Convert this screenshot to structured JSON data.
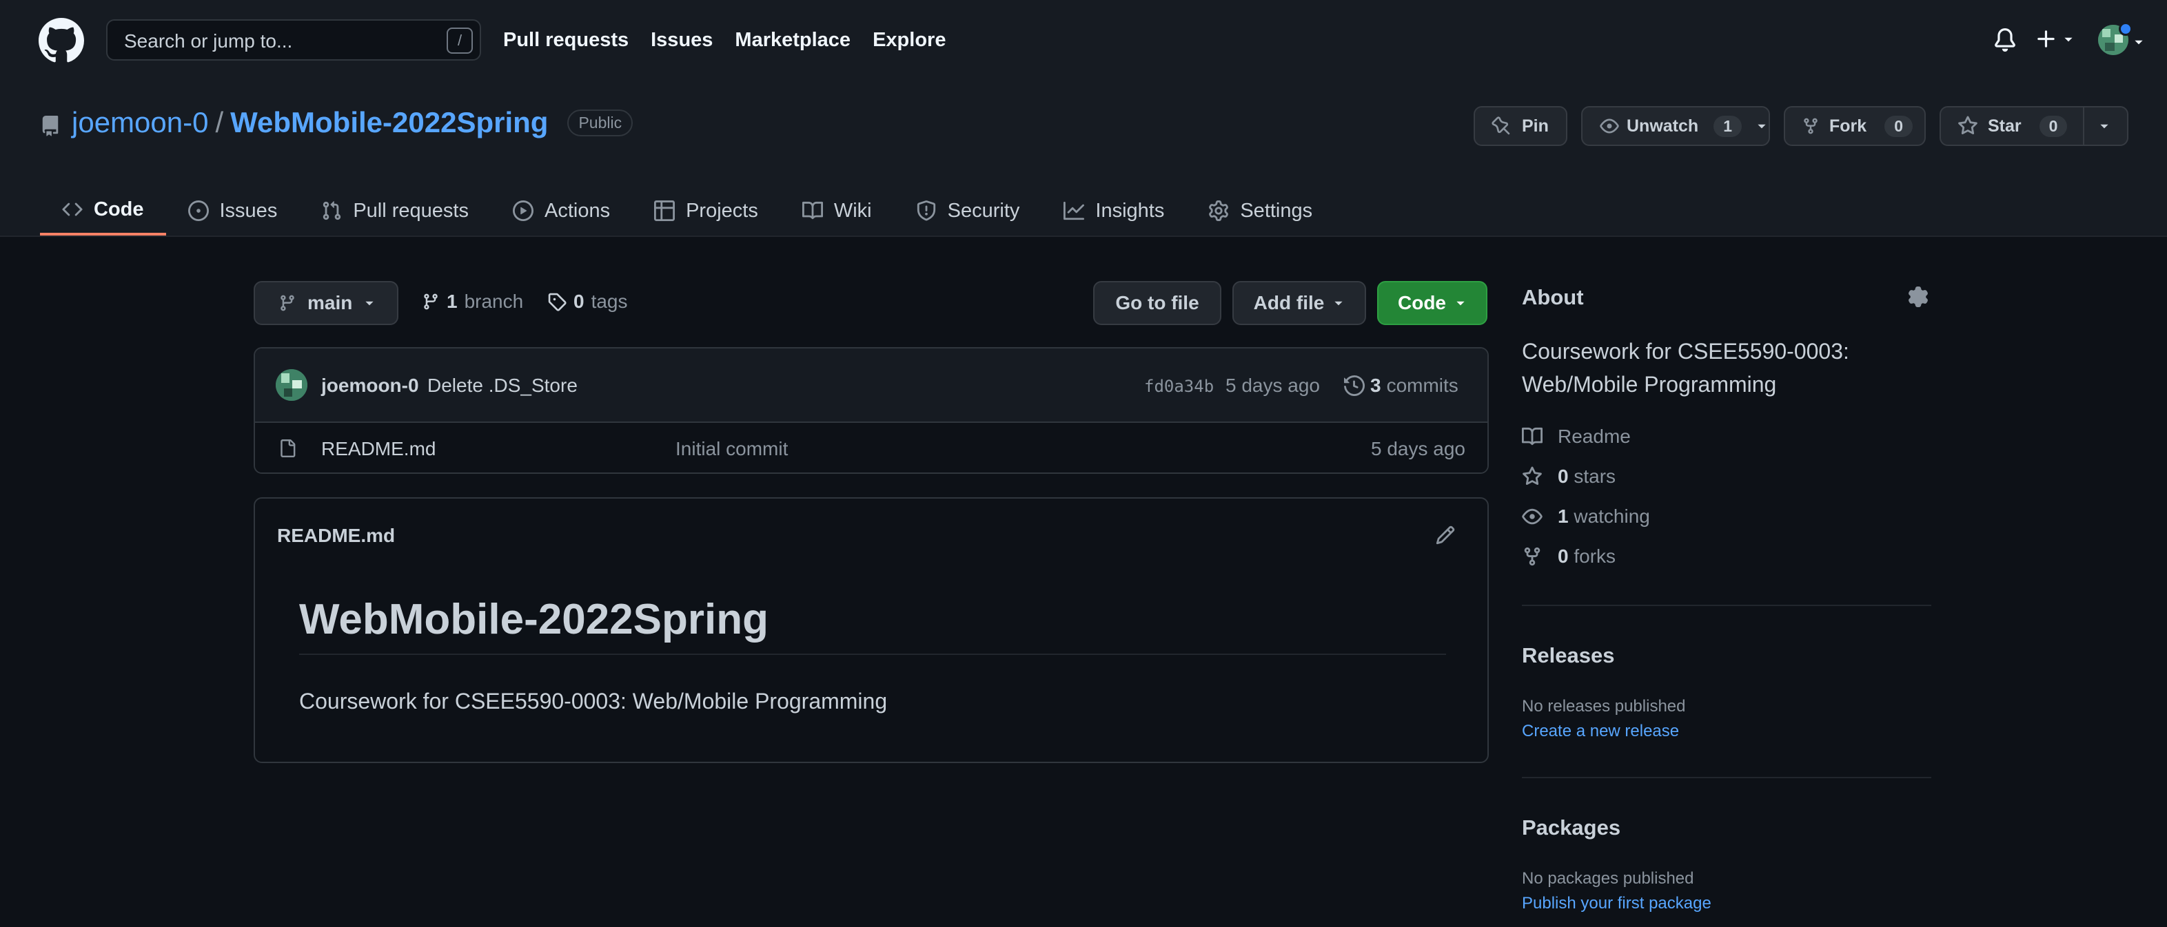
{
  "header": {
    "search_placeholder": "Search or jump to...",
    "search_shortcut": "/",
    "nav": [
      "Pull requests",
      "Issues",
      "Marketplace",
      "Explore"
    ]
  },
  "repo": {
    "owner": "joemoon-0",
    "separator": "/",
    "name": "WebMobile-2022Spring",
    "visibility": "Public",
    "actions": {
      "pin": "Pin",
      "watch": "Unwatch",
      "watch_count": "1",
      "fork": "Fork",
      "fork_count": "0",
      "star": "Star",
      "star_count": "0"
    },
    "tabs": [
      "Code",
      "Issues",
      "Pull requests",
      "Actions",
      "Projects",
      "Wiki",
      "Security",
      "Insights",
      "Settings"
    ]
  },
  "toolbar": {
    "branch": "main",
    "branch_count": "1",
    "branch_label": "branch",
    "tag_count": "0",
    "tag_label": "tags",
    "goto_file": "Go to file",
    "add_file": "Add file",
    "code": "Code"
  },
  "latest_commit": {
    "author": "joemoon-0",
    "message": "Delete .DS_Store",
    "sha": "fd0a34b",
    "time": "5 days ago",
    "count": "3",
    "count_label": "commits"
  },
  "files": [
    {
      "name": "README.md",
      "message": "Initial commit",
      "time": "5 days ago"
    }
  ],
  "readme": {
    "filename": "README.md",
    "heading": "WebMobile-2022Spring",
    "body": "Coursework for CSEE5590-0003: Web/Mobile Programming"
  },
  "about": {
    "title": "About",
    "description": "Coursework for CSEE5590-0003: Web/Mobile Programming",
    "readme": "Readme",
    "stars_count": "0",
    "stars_label": "stars",
    "watching_count": "1",
    "watching_label": "watching",
    "forks_count": "0",
    "forks_label": "forks"
  },
  "releases": {
    "title": "Releases",
    "note": "No releases published",
    "link": "Create a new release"
  },
  "packages": {
    "title": "Packages",
    "note": "No packages published",
    "link": "Publish your first package"
  },
  "colors": {
    "background": "#0d1117",
    "header": "#161b22",
    "link": "#58a6ff",
    "primary_button": "#238636",
    "tab_underline": "#f78166"
  }
}
